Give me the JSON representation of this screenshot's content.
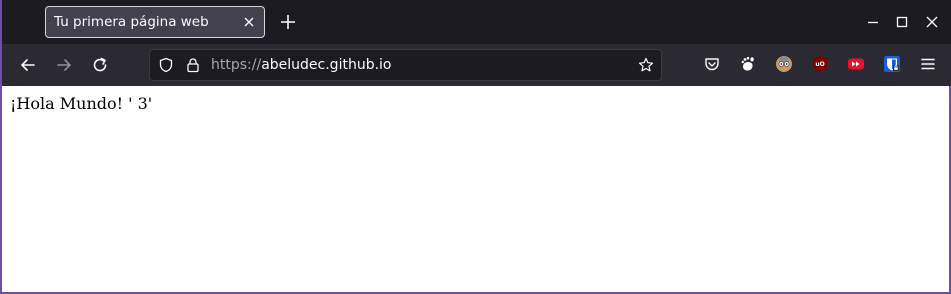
{
  "tab": {
    "title": "Tu primera página web"
  },
  "urlbar": {
    "scheme": "https://",
    "host": "abeludec.github.io"
  },
  "page": {
    "text": "¡Hola Mundo! ' 3'"
  },
  "toolbar": {
    "icons": [
      "back-icon",
      "forward-icon",
      "reload-icon",
      "shield-icon",
      "lock-icon",
      "star-icon",
      "pocket-icon",
      "gnome-extension-icon",
      "avatar-extension-icon",
      "ublock-icon",
      "youtube-extension-icon",
      "bitwarden-icon",
      "menu-icon"
    ]
  },
  "colors": {
    "tabbar_bg": "#1c1b22",
    "navbar_bg": "#2b2a33",
    "urlbar_bg": "#1c1b22",
    "window_border": "#6b4fa8"
  }
}
